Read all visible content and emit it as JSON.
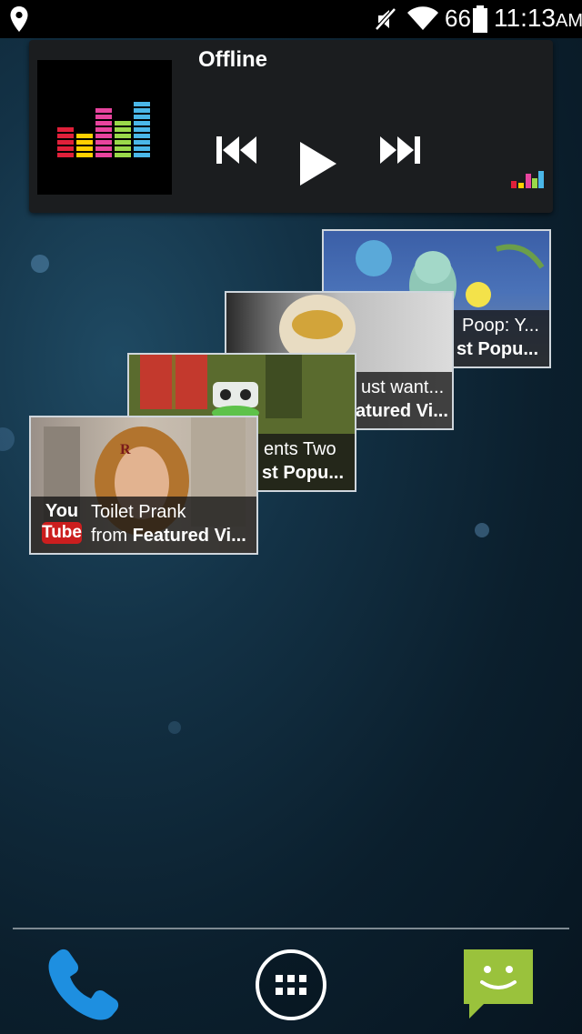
{
  "status_bar": {
    "battery_level": "66",
    "time": "11:13",
    "ampm": "AM",
    "icons": [
      "location-pin-icon",
      "mute-icon",
      "wifi-icon",
      "battery-icon"
    ]
  },
  "music_widget": {
    "status": "Offline",
    "controls": [
      "previous-icon",
      "play-icon",
      "next-icon"
    ]
  },
  "youtube_widget": {
    "logo_you": "You",
    "logo_tube": "Tube",
    "cards": [
      {
        "title": "Toilet Prank",
        "from_label": "from",
        "source": "Featured Vi..."
      },
      {
        "title": "ents Two",
        "from_label": "",
        "source": "st Popu..."
      },
      {
        "title": "ust want...",
        "from_label": "",
        "source": "atured Vi..."
      },
      {
        "title": "Poop: Y...",
        "from_label": "",
        "source": "st Popu..."
      }
    ]
  },
  "dock": {
    "items": [
      "phone-icon",
      "app-drawer-icon",
      "messaging-icon"
    ]
  },
  "colors": {
    "youtube_red": "#cc1e1e",
    "phone_blue": "#1e8fe0",
    "messaging_green": "#9ac23c"
  }
}
